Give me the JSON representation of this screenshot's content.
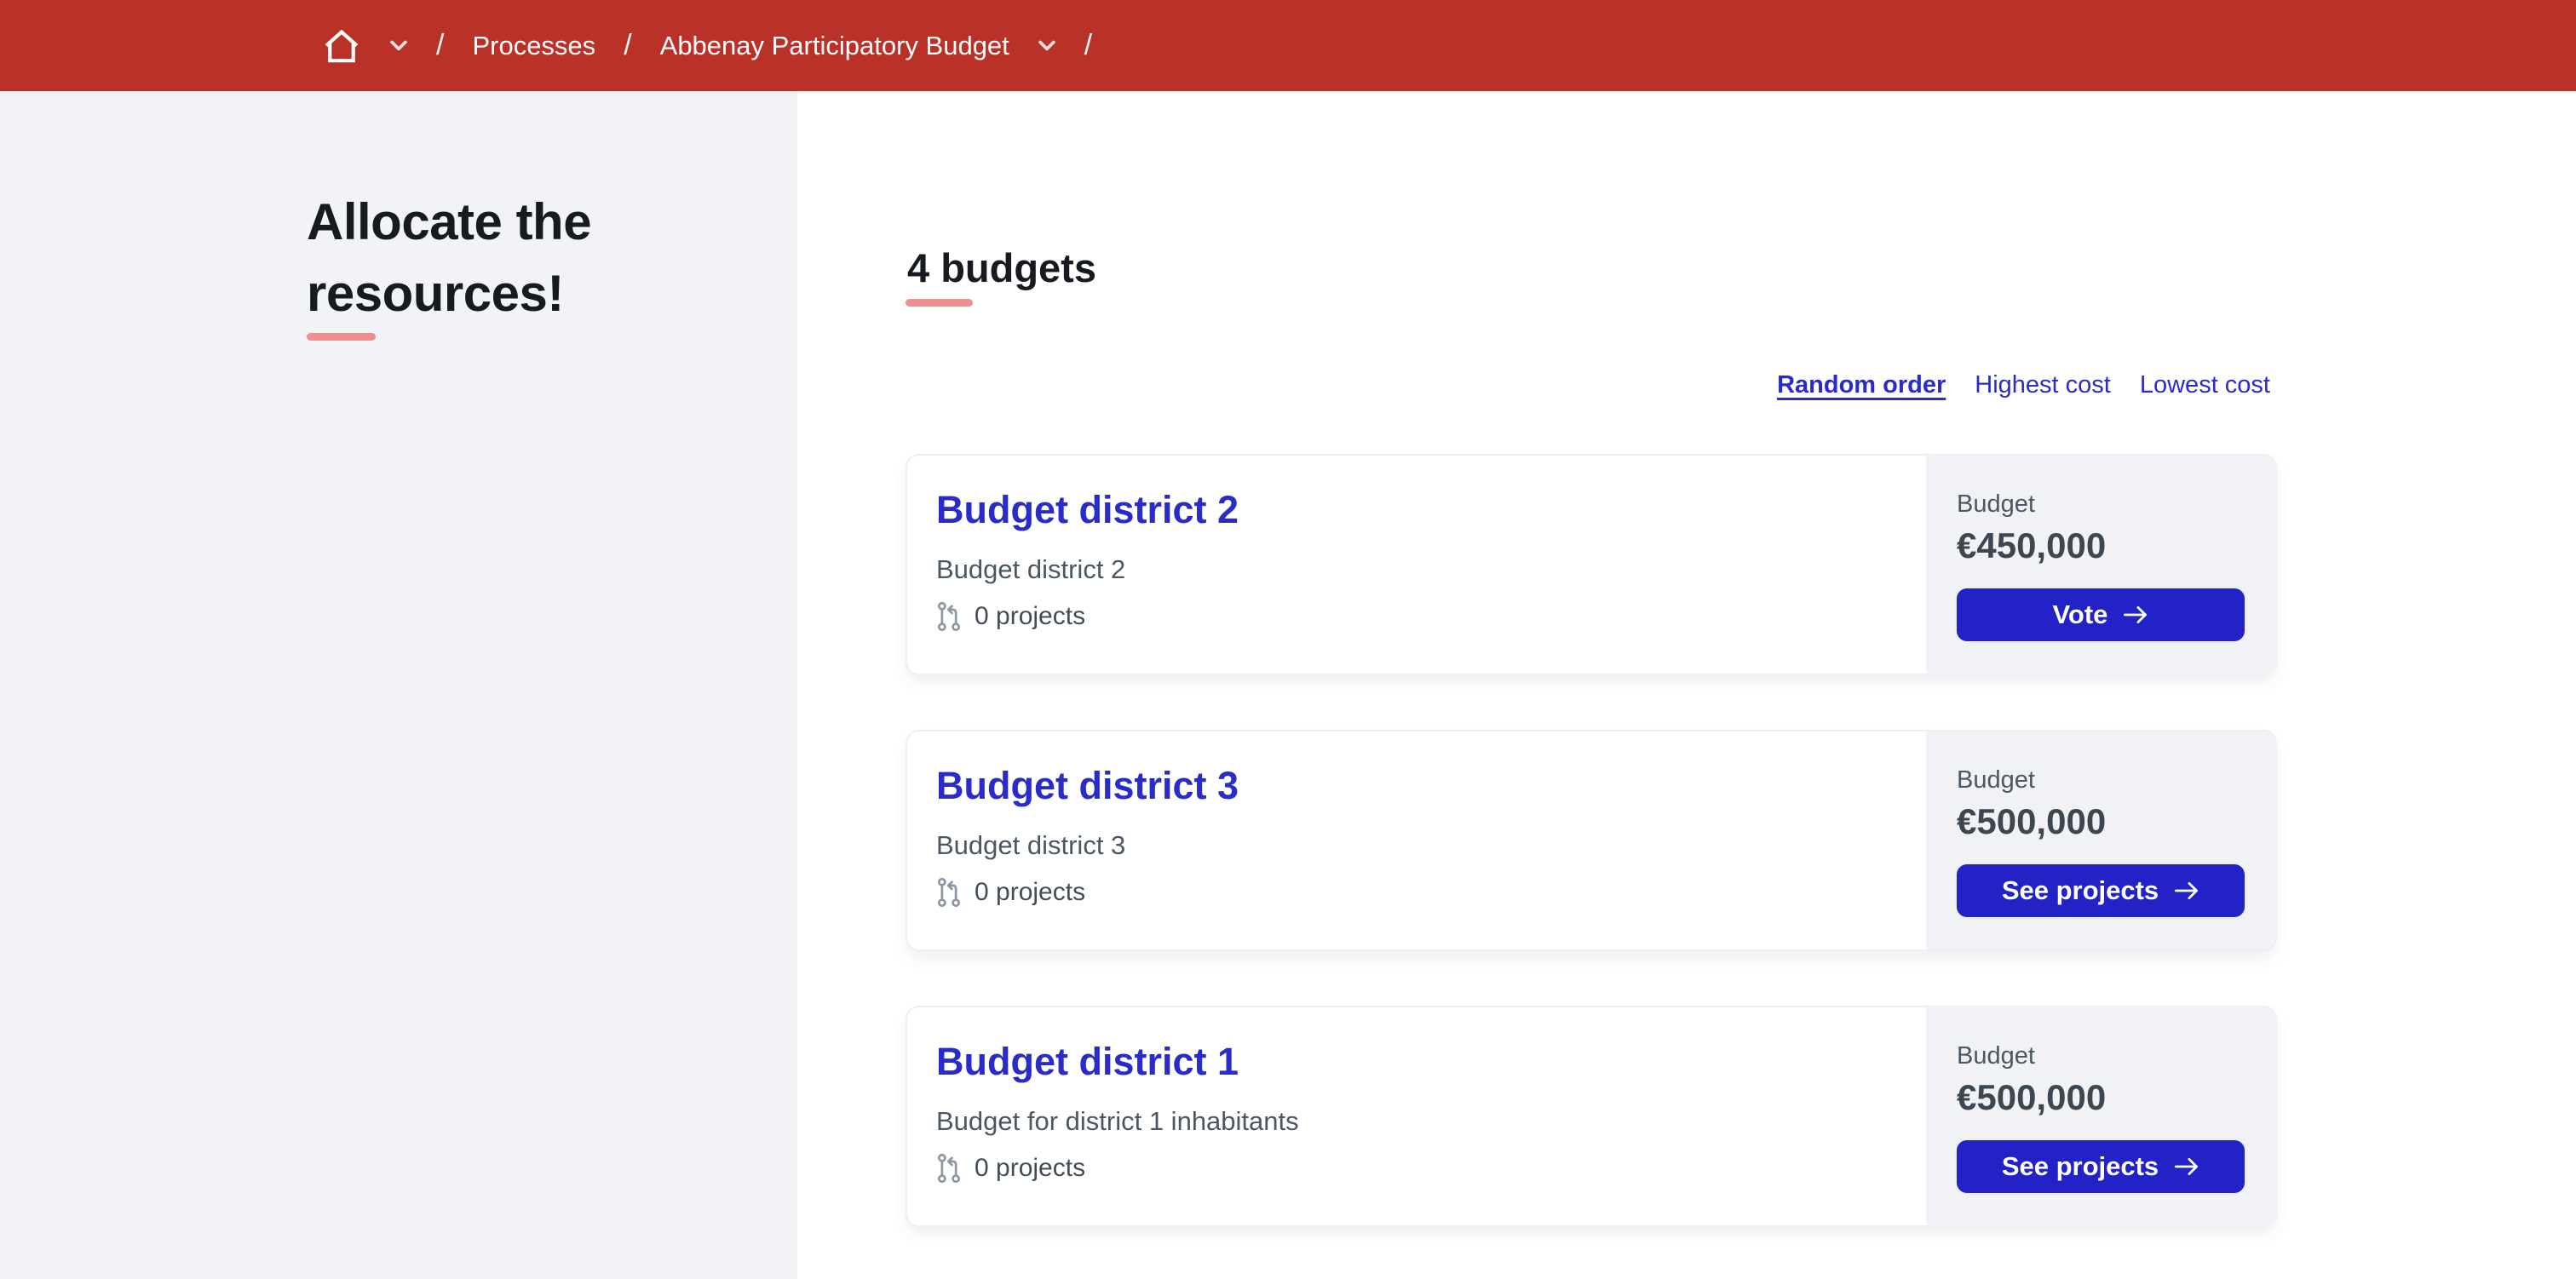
{
  "colors": {
    "topbar_bg": "#b93127",
    "accent_blue": "#2a2cc9",
    "button_blue": "#2222c7",
    "underline_salmon": "#f08e8d",
    "heading_text": "#171a21",
    "muted_text": "#4a5764",
    "amount_text": "#3d4751",
    "icon_gray": "#8d97a3",
    "sidebar_bg": "#f2f3f6",
    "panel_bg": "#f0f2f6"
  },
  "breadcrumb": {
    "separator": "/",
    "home_icon": "home-icon",
    "items": [
      {
        "label": "Processes",
        "has_dropdown": false
      },
      {
        "label": "Abbenay Participatory Budget",
        "has_dropdown": true
      }
    ]
  },
  "sidebar": {
    "title": "Allocate the resources!"
  },
  "main": {
    "heading": "4 budgets",
    "sort_options": [
      {
        "label": "Random order",
        "active": true
      },
      {
        "label": "Highest cost",
        "active": false
      },
      {
        "label": "Lowest cost",
        "active": false
      }
    ],
    "cards": [
      {
        "title": "Budget district 2",
        "description": "Budget district 2",
        "projects_count": "0 projects",
        "budget_label": "Budget",
        "amount": "€450,000",
        "cta_label": "Vote"
      },
      {
        "title": "Budget district 3",
        "description": "Budget district 3",
        "projects_count": "0 projects",
        "budget_label": "Budget",
        "amount": "€500,000",
        "cta_label": "See projects"
      },
      {
        "title": "Budget district 1",
        "description": "Budget for district 1 inhabitants",
        "projects_count": "0 projects",
        "budget_label": "Budget",
        "amount": "€500,000",
        "cta_label": "See projects"
      }
    ]
  }
}
